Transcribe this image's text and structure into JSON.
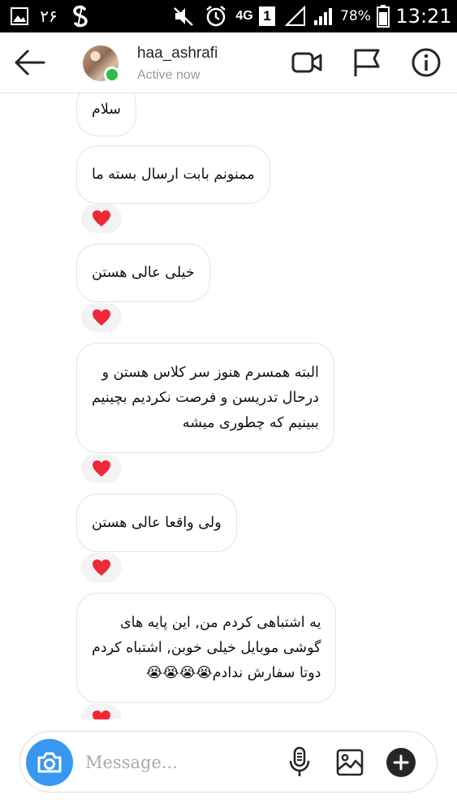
{
  "status_bar": {
    "notification_count": "۲۶",
    "network": "4G",
    "sim": "1",
    "battery": "78%",
    "time": "13:21"
  },
  "header": {
    "username": "haa_ashrafi",
    "status": "Active now"
  },
  "messages": [
    {
      "text": "سلام",
      "lines": [
        "سلام"
      ],
      "reaction": null
    },
    {
      "text": "ممنونم بابت ارسال بسته ما",
      "lines": [
        "ممنونم بابت ارسال بسته ما"
      ],
      "reaction": "heart"
    },
    {
      "text": "خیلی عالی هستن",
      "lines": [
        "خیلی عالی هستن"
      ],
      "reaction": "heart"
    },
    {
      "text": "البته همسرم هنوز سر کلاس هستن و درحال تدریسن و فرصت نکردیم بچینیم ببینیم که چطوری میشه",
      "lines": [
        "البته همسرم هنوز سر کلاس هستن و",
        "درحال تدریسن و فرصت نکردیم بچینیم",
        "ببینیم که چطوری میشه"
      ],
      "reaction": "heart"
    },
    {
      "text": "ولی واقعا عالی هستن",
      "lines": [
        "ولی واقعا عالی هستن"
      ],
      "reaction": "heart"
    },
    {
      "text": "یه اشتباهی کردم من, این پایه های گوشی موبایل خیلی خوبن, اشتباه کردم دوتا سفارش ندادم😭😭😭😭",
      "lines": [
        "یه اشتباهی کردم من, این پایه های",
        "گوشی موبایل خیلی خوبن, اشتباه کردم",
        "دوتا سفارش ندادم😭😭😭😭"
      ],
      "reaction": "heart"
    }
  ],
  "composer": {
    "placeholder": "Message..."
  },
  "icons": {
    "back": "back-arrow-icon",
    "video": "video-camera-icon",
    "flag": "flag-icon",
    "info": "info-icon",
    "camera": "camera-icon",
    "mic": "microphone-icon",
    "gallery": "image-gallery-icon",
    "add": "add-icon",
    "reaction": "heart-icon"
  },
  "colors": {
    "accent_blue": "#3897f0",
    "online_green": "#2fbd4a",
    "heart_red": "#ed2938"
  }
}
